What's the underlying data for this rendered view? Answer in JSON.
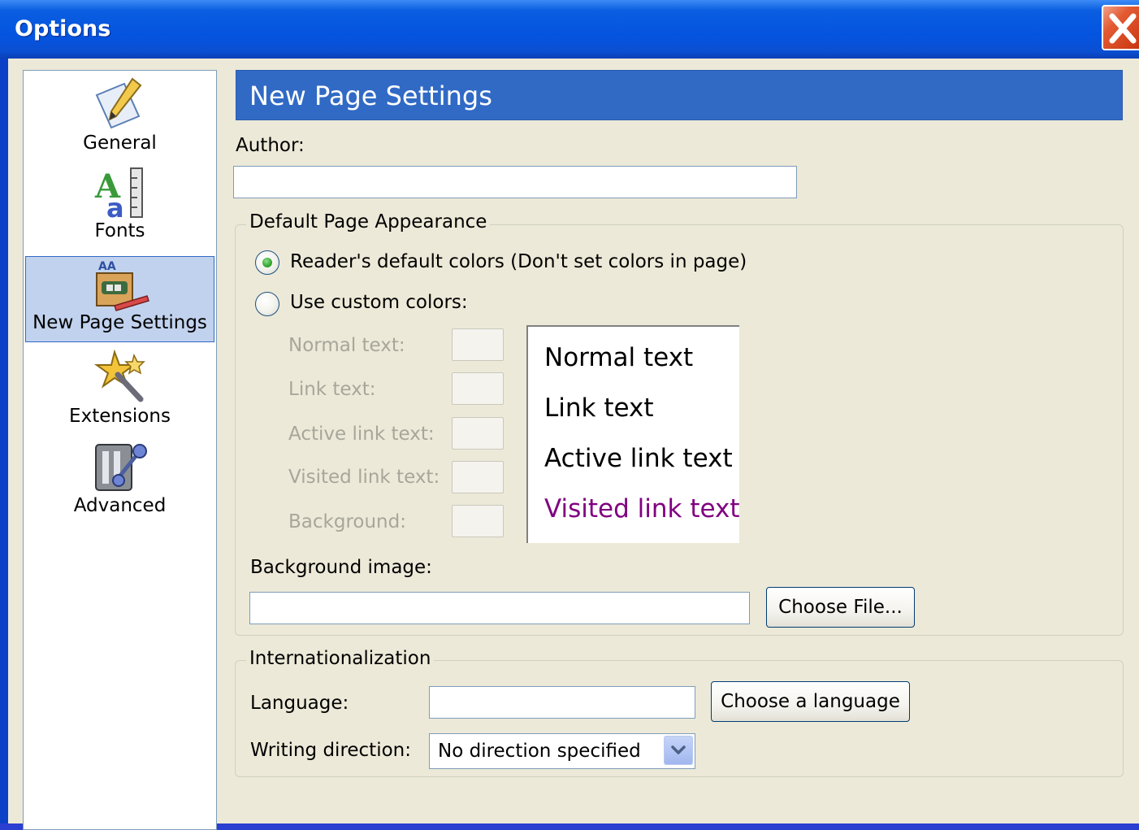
{
  "window": {
    "title": "Options"
  },
  "sidebar": {
    "items": [
      {
        "label": "General",
        "icon": "pencil-paper-icon"
      },
      {
        "label": "Fonts",
        "icon": "fonts-icon"
      },
      {
        "label": "New Page Settings",
        "icon": "new-page-settings-icon",
        "selected": true
      },
      {
        "label": "Extensions",
        "icon": "extensions-wand-icon"
      },
      {
        "label": "Advanced",
        "icon": "advanced-icon"
      }
    ]
  },
  "panel": {
    "header": "New Page Settings",
    "author_label": "Author:",
    "author_value": "",
    "appearance": {
      "caption": "Default Page Appearance",
      "option_default": "Reader's default colors (Don't set colors in page)",
      "option_custom": "Use custom colors:",
      "selected": "default",
      "color_labels": [
        "Normal text:",
        "Link text:",
        "Active link text:",
        "Visited link text:",
        "Background:"
      ],
      "preview": {
        "normal": "Normal text",
        "link": "Link text",
        "active": "Active link text",
        "visited": "Visited link text"
      },
      "preview_colors": {
        "normal": "#000000",
        "link": "#000000",
        "active": "#000000",
        "visited": "#800080"
      },
      "background_image_label": "Background image:",
      "background_image_value": "",
      "choose_file": "Choose File..."
    },
    "i18n": {
      "caption": "Internationalization",
      "language_label": "Language:",
      "language_value": "",
      "choose_language": "Choose a language",
      "direction_label": "Writing direction:",
      "direction_value": "No direction specified"
    }
  },
  "colors": {
    "titlebar": "#0554e0",
    "header": "#316ac5",
    "dialog_bg": "#ece9d8",
    "selection": "#c1d2ee"
  }
}
